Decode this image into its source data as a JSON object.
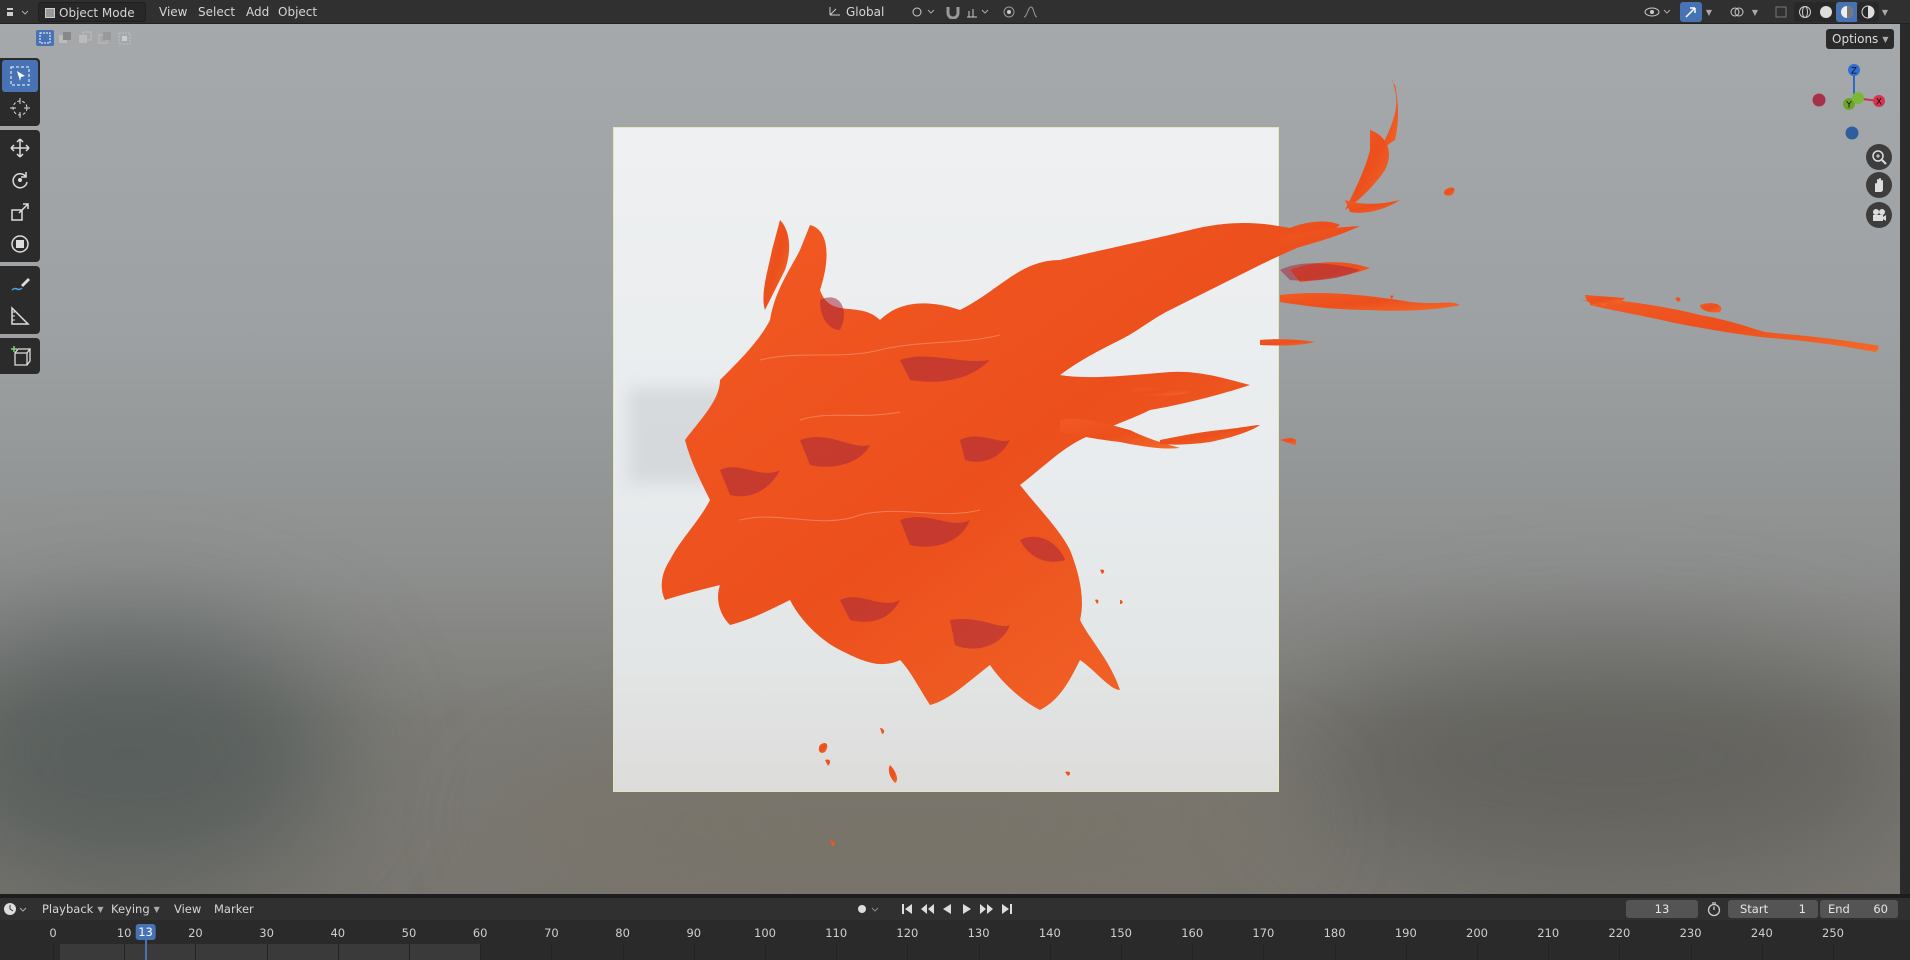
{
  "header": {
    "mode_label": "Object Mode",
    "menus": [
      "View",
      "Select",
      "Add",
      "Object"
    ],
    "orientation_label": "Global"
  },
  "viewport": {
    "options_label": "Options",
    "gizmo": {
      "z": "Z",
      "y": "Y",
      "x": "X"
    }
  },
  "toolbar": {
    "tools": [
      "select-box-icon",
      "cursor-icon",
      "move-icon",
      "rotate-icon",
      "scale-icon",
      "transform-icon",
      "annotate-icon",
      "measure-icon",
      "add-cube-icon"
    ]
  },
  "timeline": {
    "menus": [
      "Playback",
      "Keying",
      "View",
      "Marker"
    ],
    "current_frame": "13",
    "start_label": "Start",
    "start_value": "1",
    "end_label": "End",
    "end_value": "60",
    "ticks": [
      "0",
      "10",
      "20",
      "30",
      "40",
      "50",
      "60",
      "70",
      "80",
      "90",
      "100",
      "110",
      "120",
      "130",
      "140",
      "150",
      "160",
      "170",
      "180",
      "190",
      "200",
      "210",
      "220",
      "230",
      "240",
      "250"
    ],
    "playhead_label": "13"
  },
  "colors": {
    "accent": "#4772b3",
    "splash": "#f0531e",
    "splash_dark": "#b02a3a",
    "frame_border": "#e7e6b8"
  }
}
